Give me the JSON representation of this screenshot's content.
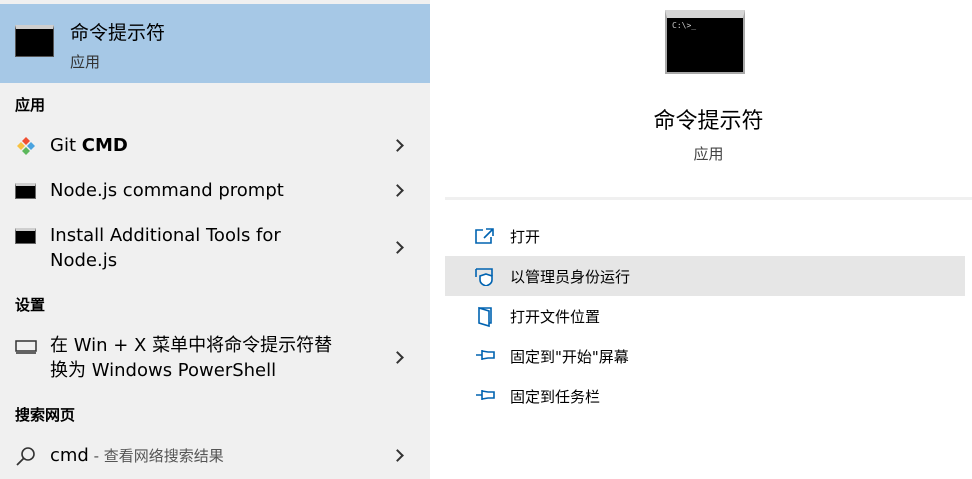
{
  "best_match": {
    "title": "命令提示符",
    "subtitle": "应用"
  },
  "sections": {
    "apps": "应用",
    "settings": "设置",
    "web": "搜索网页"
  },
  "apps": [
    {
      "label_pre": "Git ",
      "label_bold": "CMD",
      "icon": "git-icon"
    },
    {
      "label": "Node.js command prompt",
      "icon": "console-icon"
    },
    {
      "label_line1": "Install Additional Tools for",
      "label_line2": "Node.js",
      "icon": "console-icon"
    }
  ],
  "settings": [
    {
      "label_line1": "在 Win + X 菜单中将命令提示符替",
      "label_line2": "换为 Windows PowerShell",
      "icon": "monitor-icon"
    }
  ],
  "web": {
    "query": "cmd",
    "suffix": " - 查看网络搜索结果",
    "icon": "search-icon"
  },
  "detail": {
    "title": "命令提示符",
    "subtitle": "应用",
    "icon_prompt": "C:\\>_",
    "actions": [
      {
        "label": "打开",
        "icon": "open-icon"
      },
      {
        "label": "以管理员身份运行",
        "icon": "shield-icon"
      },
      {
        "label": "打开文件位置",
        "icon": "folder-location-icon"
      },
      {
        "label": "固定到\"开始\"屏幕",
        "icon": "pin-icon"
      },
      {
        "label": "固定到任务栏",
        "icon": "pin-icon"
      }
    ]
  },
  "colors": {
    "selected": "#a6c8e6",
    "left_bg": "#f0f0f0",
    "icon_blue": "#0063b1",
    "hover": "#e6e6e6"
  }
}
